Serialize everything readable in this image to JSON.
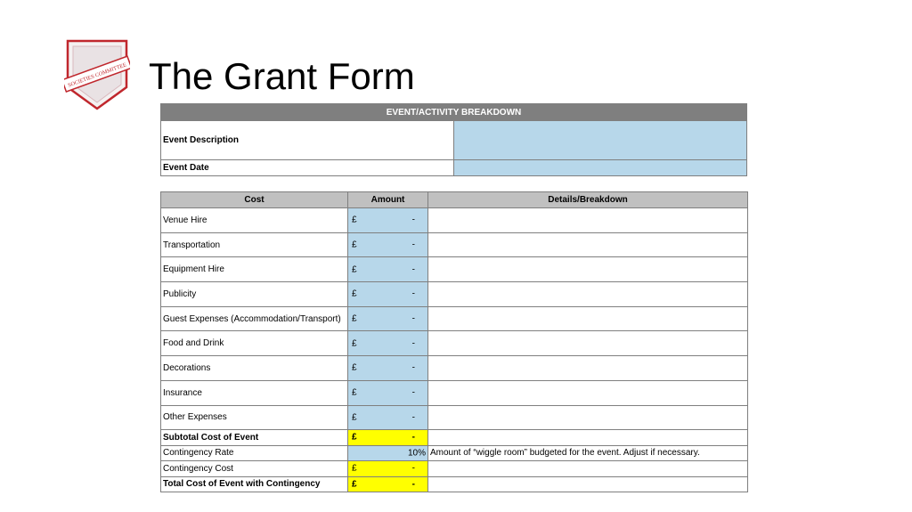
{
  "slide": {
    "title": "The Grant Form",
    "logo_text": "SOCIETIES COMMITTEE"
  },
  "event_table": {
    "header": "EVENT/ACTIVITY BREAKDOWN",
    "rows": [
      {
        "label": "Event Description",
        "value": ""
      },
      {
        "label": "Event Date",
        "value": ""
      }
    ]
  },
  "cost_table": {
    "columns": [
      "Cost",
      "Amount",
      "Details/Breakdown"
    ],
    "items": [
      {
        "label": "Venue Hire",
        "currency": "£",
        "amount": "-",
        "details": ""
      },
      {
        "label": "Transportation",
        "currency": "£",
        "amount": "-",
        "details": ""
      },
      {
        "label": "Equipment Hire",
        "currency": "£",
        "amount": "-",
        "details": ""
      },
      {
        "label": "Publicity",
        "currency": "£",
        "amount": "-",
        "details": ""
      },
      {
        "label": "Guest Expenses (Accommodation/Transport)",
        "currency": "£",
        "amount": "-",
        "details": ""
      },
      {
        "label": "Food and Drink",
        "currency": "£",
        "amount": "-",
        "details": ""
      },
      {
        "label": "Decorations",
        "currency": "£",
        "amount": "-",
        "details": ""
      },
      {
        "label": "Insurance",
        "currency": "£",
        "amount": "-",
        "details": ""
      },
      {
        "label": "Other Expenses",
        "currency": "£",
        "amount": "-",
        "details": ""
      }
    ],
    "subtotal": {
      "label": "Subtotal Cost of Event",
      "currency": "£",
      "amount": "-"
    },
    "contingency_rate": {
      "label": "Contingency Rate",
      "value": "10%",
      "note": "Amount of “wiggle room” budgeted for the event. Adjust if necessary."
    },
    "contingency_cost": {
      "label": "Contingency Cost",
      "currency": "£",
      "amount": "-"
    },
    "total": {
      "label": "Total Cost of Event with Contingency",
      "currency": "£",
      "amount": "-"
    }
  },
  "colors": {
    "header_dark": "#7f7f7f",
    "header_light": "#c0c0c0",
    "input_blue": "#b7d7ea",
    "highlight_yellow": "#ffff00",
    "logo_red": "#c0272d"
  }
}
